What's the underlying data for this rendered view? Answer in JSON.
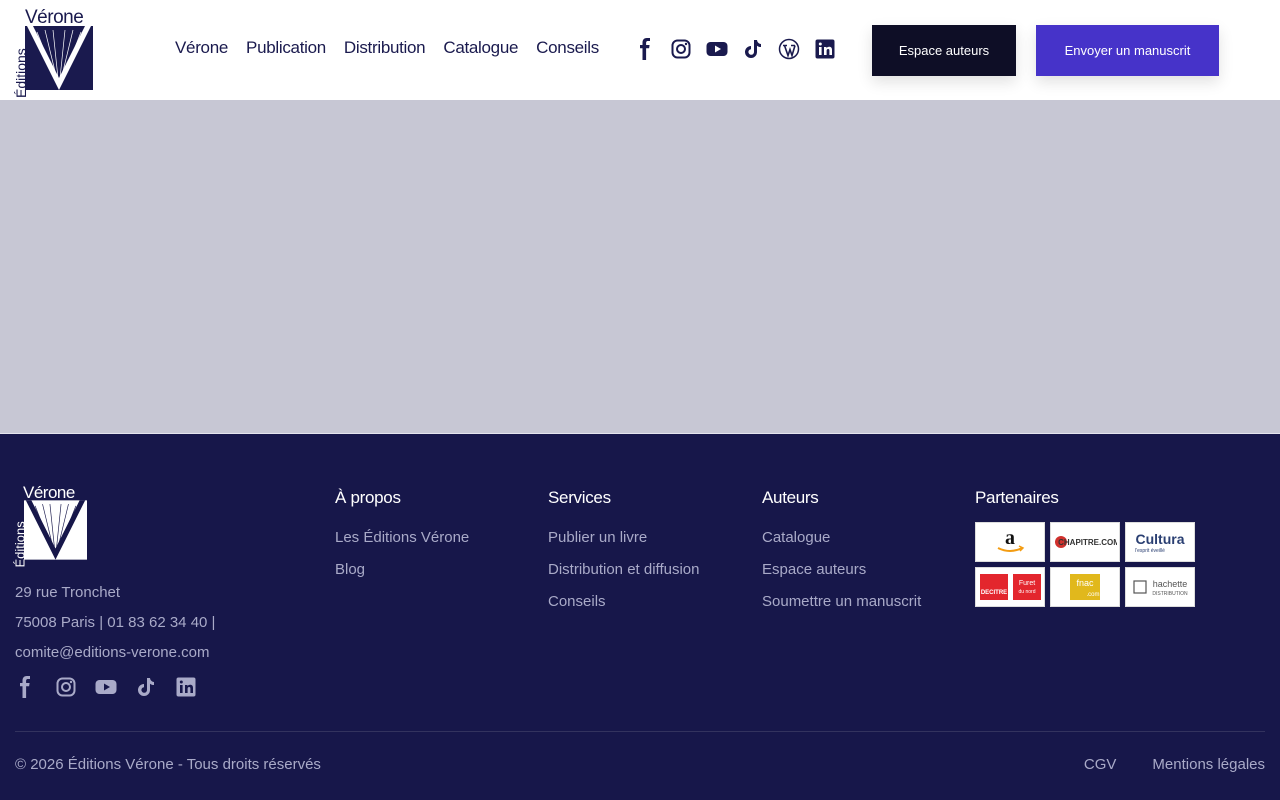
{
  "brand": {
    "wordmark": "Vérone",
    "side_text": "Éditions"
  },
  "nav": {
    "items": [
      "Vérone",
      "Publication",
      "Distribution",
      "Catalogue",
      "Conseils"
    ]
  },
  "social_icons": [
    "facebook-icon",
    "instagram-icon",
    "youtube-icon",
    "tiktok-icon",
    "wordpress-icon",
    "linkedin-icon"
  ],
  "header_buttons": {
    "authors_label": "Espace auteurs",
    "manuscript_label": "Envoyer un manuscrit"
  },
  "colors": {
    "navy": "#17174a",
    "dark_button": "#0e0e26",
    "accent": "#4633c9",
    "hero_placeholder": "#c7c7d4"
  },
  "footer": {
    "contact": {
      "address": "29 rue Tronchet",
      "city_phone": "75008 Paris | 01 83 62 34 40 |",
      "email": "comite@editions-verone.com"
    },
    "social_icons": [
      "facebook-icon",
      "instagram-icon",
      "youtube-icon",
      "tiktok-icon",
      "linkedin-icon"
    ],
    "about": {
      "title": "À propos",
      "links": [
        "Les Éditions Vérone",
        "Blog"
      ]
    },
    "services": {
      "title": "Services",
      "links": [
        "Publier un livre",
        "Distribution et diffusion",
        "Conseils"
      ]
    },
    "authors": {
      "title": "Auteurs",
      "links": [
        "Catalogue",
        "Espace auteurs",
        "Soumettre un manuscrit"
      ]
    },
    "partners": {
      "title": "Partenaires",
      "logos": [
        "amazon",
        "chapitre.com",
        "Cultura",
        "Decitre / Furet du nord",
        "fnac.com",
        "hachette DISTRIBUTION"
      ]
    },
    "copyright": "© 2026 Éditions Vérone - Tous droits réservés",
    "legal": {
      "cgv": "CGV",
      "mentions": "Mentions légales"
    }
  }
}
